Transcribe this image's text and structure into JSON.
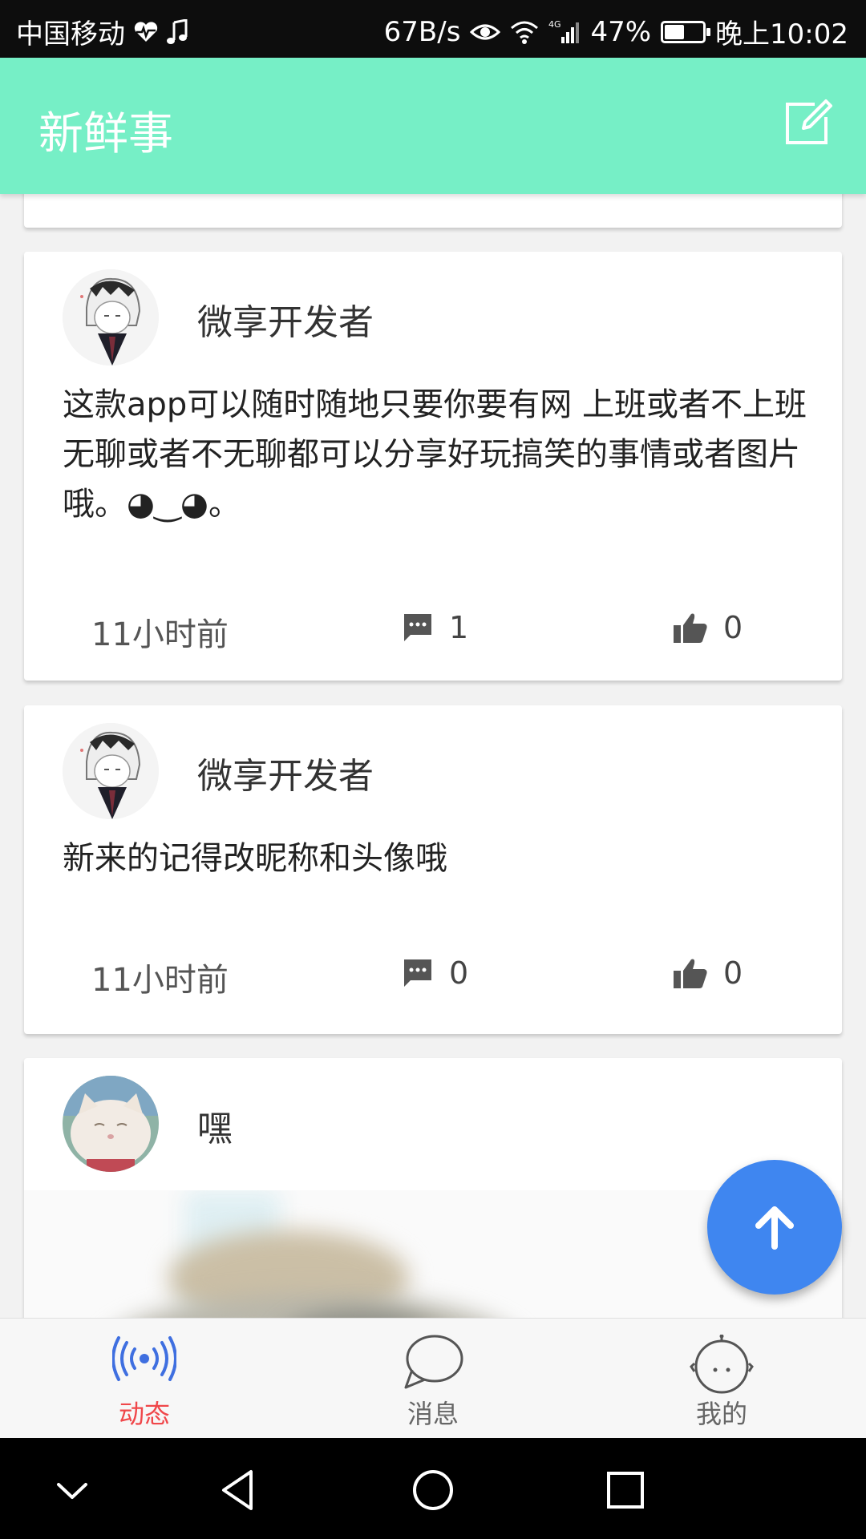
{
  "status_bar": {
    "carrier": "中国移动",
    "speed": "67B/s",
    "network": "4G",
    "battery": "47%",
    "battery_level": 0.47,
    "time": "晚上10:02"
  },
  "header": {
    "title": "新鲜事",
    "compose_icon": "edit-icon"
  },
  "feed": {
    "posts": [
      {
        "author": "微享开发者",
        "content": "这款app可以随时随地只要你要有网 上班或者不上班无聊或者不无聊都可以分享好玩搞笑的事情或者图片哦。◕‿◕。",
        "time": "11小时前",
        "comments": "1",
        "likes": "0"
      },
      {
        "author": "微享开发者",
        "content": "新来的记得改昵称和头像哦",
        "time": "11小时前",
        "comments": "0",
        "likes": "0"
      },
      {
        "author": "嘿"
      }
    ]
  },
  "fab": {
    "icon": "arrow-up-icon"
  },
  "tabs": [
    {
      "label": "动态",
      "icon": "broadcast-icon",
      "active": true
    },
    {
      "label": "消息",
      "icon": "chat-bubble-icon",
      "active": false
    },
    {
      "label": "我的",
      "icon": "person-face-icon",
      "active": false
    }
  ],
  "colors": {
    "header_bg": "#76efc6",
    "fab_bg": "#3f86f0",
    "tab_active": "#f0474a",
    "tab_active_icon": "#3f6fe0"
  }
}
